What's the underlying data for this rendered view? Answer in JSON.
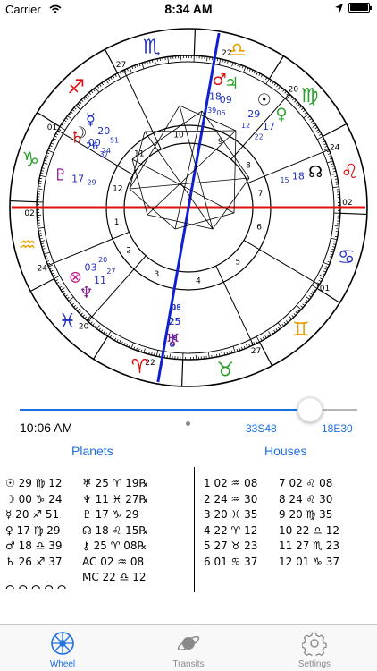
{
  "status_bar": {
    "carrier": "Carrier",
    "time": "8:34 AM"
  },
  "wheel": {
    "house_cusps": [
      {
        "number": "10",
        "degree": "22"
      },
      {
        "number": "4",
        "degree": "22"
      },
      {
        "number": "1",
        "degree": "02"
      },
      {
        "number": "7",
        "degree": "02"
      },
      {
        "number": "11",
        "degree": "27"
      },
      {
        "number": "12",
        "degree": "01"
      },
      {
        "number": "2",
        "degree": "24"
      },
      {
        "number": "3",
        "degree": "20"
      },
      {
        "number": "5",
        "degree": "27"
      },
      {
        "number": "6",
        "degree": "01"
      },
      {
        "number": "8",
        "degree": "24"
      },
      {
        "number": "9",
        "degree": "20"
      }
    ],
    "planets": [
      {
        "glyph": "☉",
        "deg": "29",
        "min": "12"
      },
      {
        "glyph": "♀",
        "deg": "17",
        "min": "22"
      },
      {
        "glyph": "♃",
        "deg": "09",
        "min": "06"
      },
      {
        "glyph": "♂",
        "deg": "18",
        "min": "39"
      },
      {
        "glyph": "☿",
        "deg": "20",
        "min": "51"
      },
      {
        "glyph": "♄",
        "deg": "26",
        "min": "37"
      },
      {
        "glyph": "☽",
        "deg": "00",
        "min": "24"
      },
      {
        "glyph": "♇",
        "deg": "17",
        "min": "29"
      },
      {
        "glyph": "☊",
        "deg": "18",
        "min": "15"
      },
      {
        "glyph": "⊗",
        "deg": "03",
        "min": "20"
      },
      {
        "glyph": "♆",
        "deg": "11",
        "min": "27"
      },
      {
        "glyph": "⚷",
        "deg": "25",
        "min": "08"
      },
      {
        "glyph": "♅",
        "deg": "25",
        "min": "19"
      }
    ]
  },
  "time_slider": {
    "value": 0.86
  },
  "location": {
    "time": "10:06 AM",
    "latitude": "33S48",
    "longitude": "18E30"
  },
  "sections": {
    "planets": "Planets",
    "houses": "Houses"
  },
  "planet_list_col1": [
    "☉ 29 ♍ 12",
    "☽ 00 ♑ 24",
    "☿ 20 ♐ 51",
    "♀ 17 ♍ 29",
    "♂ 18 ♎ 39",
    "♄ 26 ♐ 37"
  ],
  "planet_list_col2": [
    "♅ 25 ♈ 19℞",
    "♆ 11 ♓ 27℞",
    "♇ 17 ♑ 29",
    "☊ 18 ♌ 15℞",
    "⚷ 25 ♈ 08℞",
    "AC 02 ♒ 08",
    "MC 22 ♎ 12"
  ],
  "house_list_col1": [
    "1 02 ♒ 08",
    "2 24 ♒ 30",
    "3 20 ♓ 35",
    "4 22 ♈ 12",
    "5 27 ♉ 23",
    "6 01 ♋ 37"
  ],
  "house_list_col2": [
    "7 02 ♌ 08",
    "8 24 ♌ 30",
    "9 20 ♍ 35",
    "10 22 ♎ 12",
    "11 27 ♏ 23",
    "12 01 ♑ 37"
  ],
  "tabs": [
    {
      "label": "Wheel",
      "icon": "wheel-icon",
      "active": true
    },
    {
      "label": "Transits",
      "icon": "planet-icon",
      "active": false
    },
    {
      "label": "Settings",
      "icon": "gear-icon",
      "active": false
    }
  ],
  "colors": {
    "accent": "#1c6fe0",
    "axis_horizon": "#e01010",
    "axis_meridian": "#1020d0",
    "fire": "#e01010",
    "earth": "#2aa02a",
    "air": "#e8a000",
    "water": "#2030c0"
  }
}
